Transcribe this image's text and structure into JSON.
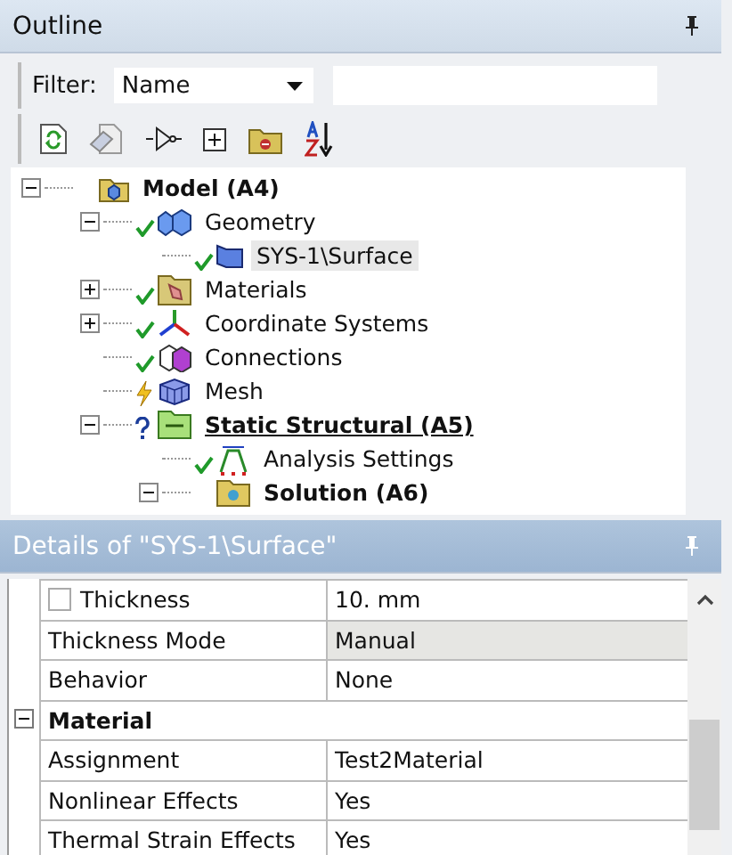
{
  "outline": {
    "title": "Outline",
    "filter": {
      "label": "Filter:",
      "value": "Name"
    },
    "tree": [
      {
        "label": "Model (A4)",
        "kind": "model",
        "bold": true,
        "expanded": true,
        "selected": false,
        "children": [
          {
            "label": "Geometry",
            "kind": "geometry",
            "status": {
              "kind": "check"
            },
            "expanded": true,
            "selected": false,
            "children": [
              {
                "label": "SYS-1\\Surface",
                "kind": "surface",
                "status": {
                  "kind": "check"
                },
                "selected": true
              }
            ]
          },
          {
            "label": "Materials",
            "kind": "materials",
            "status": {
              "kind": "check"
            },
            "expanded": false,
            "selected": false
          },
          {
            "label": "Coordinate Systems",
            "kind": "coords",
            "status": {
              "kind": "check"
            },
            "expanded": false,
            "selected": false
          },
          {
            "label": "Connections",
            "kind": "connections",
            "status": {
              "kind": "check"
            },
            "selected": false
          },
          {
            "label": "Mesh",
            "kind": "mesh",
            "status": {
              "kind": "lightning"
            },
            "selected": false
          },
          {
            "label": "Static Structural (A5)",
            "kind": "static",
            "status": {
              "kind": "question"
            },
            "bold": true,
            "underline": true,
            "expanded": true,
            "selected": false,
            "children": [
              {
                "label": "Analysis Settings",
                "kind": "analysis",
                "status": {
                  "kind": "check"
                },
                "selected": false
              },
              {
                "label": "Solution (A6)",
                "kind": "solution",
                "bold": true,
                "expanded": true,
                "selected": false
              }
            ]
          }
        ]
      }
    ]
  },
  "details": {
    "title": "Details of \"SYS-1\\Surface\"",
    "rows": [
      {
        "kind": "property",
        "label": "Thickness",
        "value": "10. mm",
        "checked": false
      },
      {
        "kind": "property",
        "label": "Thickness Mode",
        "value": "Manual",
        "highlighted": true
      },
      {
        "kind": "property",
        "label": "Behavior",
        "value": "None"
      },
      {
        "kind": "category",
        "label": "Material",
        "expanded": true
      },
      {
        "kind": "property",
        "label": "Assignment",
        "value": "Test2Material"
      },
      {
        "kind": "property",
        "label": "Nonlinear Effects",
        "value": "Yes"
      },
      {
        "kind": "property",
        "label": "Thermal Strain Effects",
        "value": "Yes"
      }
    ]
  }
}
